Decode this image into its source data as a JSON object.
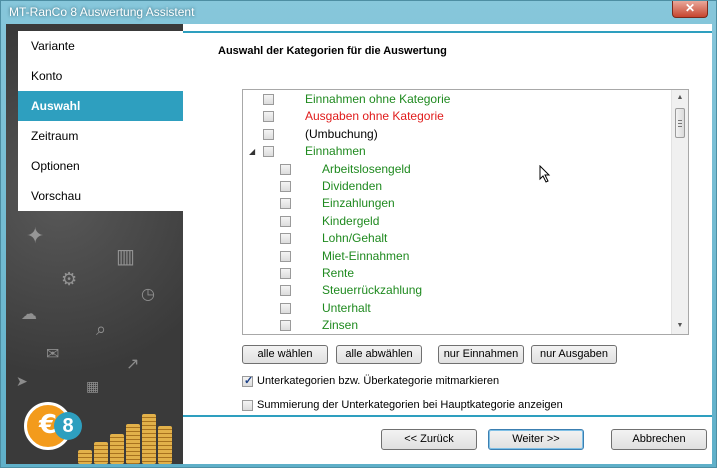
{
  "window": {
    "title": "MT-RanCo 8 Auswertung Assistent",
    "close_glyph": "✕"
  },
  "sidebar": {
    "items": [
      {
        "label": "Variante",
        "active": false
      },
      {
        "label": "Konto",
        "active": false
      },
      {
        "label": "Auswahl",
        "active": true
      },
      {
        "label": "Zeitraum",
        "active": false
      },
      {
        "label": "Optionen",
        "active": false
      },
      {
        "label": "Vorschau",
        "active": false
      }
    ],
    "logo_text": "€",
    "logo_badge": "8"
  },
  "main": {
    "heading": "Auswahl der Kategorien für die Auswertung",
    "tree": [
      {
        "label": "Einnahmen ohne Kategorie",
        "color": "#1f8a1f",
        "level": 0,
        "checked": false
      },
      {
        "label": "Ausgaben ohne Kategorie",
        "color": "#e01b1b",
        "level": 0,
        "checked": false
      },
      {
        "label": "(Umbuchung)",
        "color": "#000000",
        "level": 0,
        "checked": false
      },
      {
        "label": "Einnahmen",
        "color": "#1f8a1f",
        "level": 0,
        "checked": false,
        "expander": "◢"
      },
      {
        "label": "Arbeitslosengeld",
        "color": "#1f8a1f",
        "level": 1,
        "checked": false
      },
      {
        "label": "Dividenden",
        "color": "#1f8a1f",
        "level": 1,
        "checked": false
      },
      {
        "label": "Einzahlungen",
        "color": "#1f8a1f",
        "level": 1,
        "checked": false
      },
      {
        "label": "Kindergeld",
        "color": "#1f8a1f",
        "level": 1,
        "checked": false
      },
      {
        "label": "Lohn/Gehalt",
        "color": "#1f8a1f",
        "level": 1,
        "checked": false
      },
      {
        "label": "Miet-Einnahmen",
        "color": "#1f8a1f",
        "level": 1,
        "checked": false
      },
      {
        "label": "Rente",
        "color": "#1f8a1f",
        "level": 1,
        "checked": false
      },
      {
        "label": "Steuerrückzahlung",
        "color": "#1f8a1f",
        "level": 1,
        "checked": false
      },
      {
        "label": "Unterhalt",
        "color": "#1f8a1f",
        "level": 1,
        "checked": false
      },
      {
        "label": "Zinsen",
        "color": "#1f8a1f",
        "level": 1,
        "checked": false
      }
    ],
    "scroll_up": "▲",
    "scroll_down": "▼",
    "buttons": {
      "select_all": "alle wählen",
      "deselect_all": "alle abwählen",
      "only_income": "nur Einnahmen",
      "only_expenses": "nur Ausgaben"
    },
    "options": {
      "mark_subcategories": {
        "label": "Unterkategorien bzw. Überkategorie  mitmarkieren",
        "checked": true
      },
      "sum_subcategories": {
        "label": "Summierung der Unterkategorien bei Hauptkategorie anzeigen",
        "checked": false
      }
    },
    "checkmark_glyph": "✓"
  },
  "footer": {
    "back": "<< Zurück",
    "next": "Weiter >>",
    "cancel": "Abbrechen"
  },
  "colors": {
    "accent": "#2e9fbf",
    "income": "#1f8a1f",
    "expense": "#e01b1b"
  }
}
